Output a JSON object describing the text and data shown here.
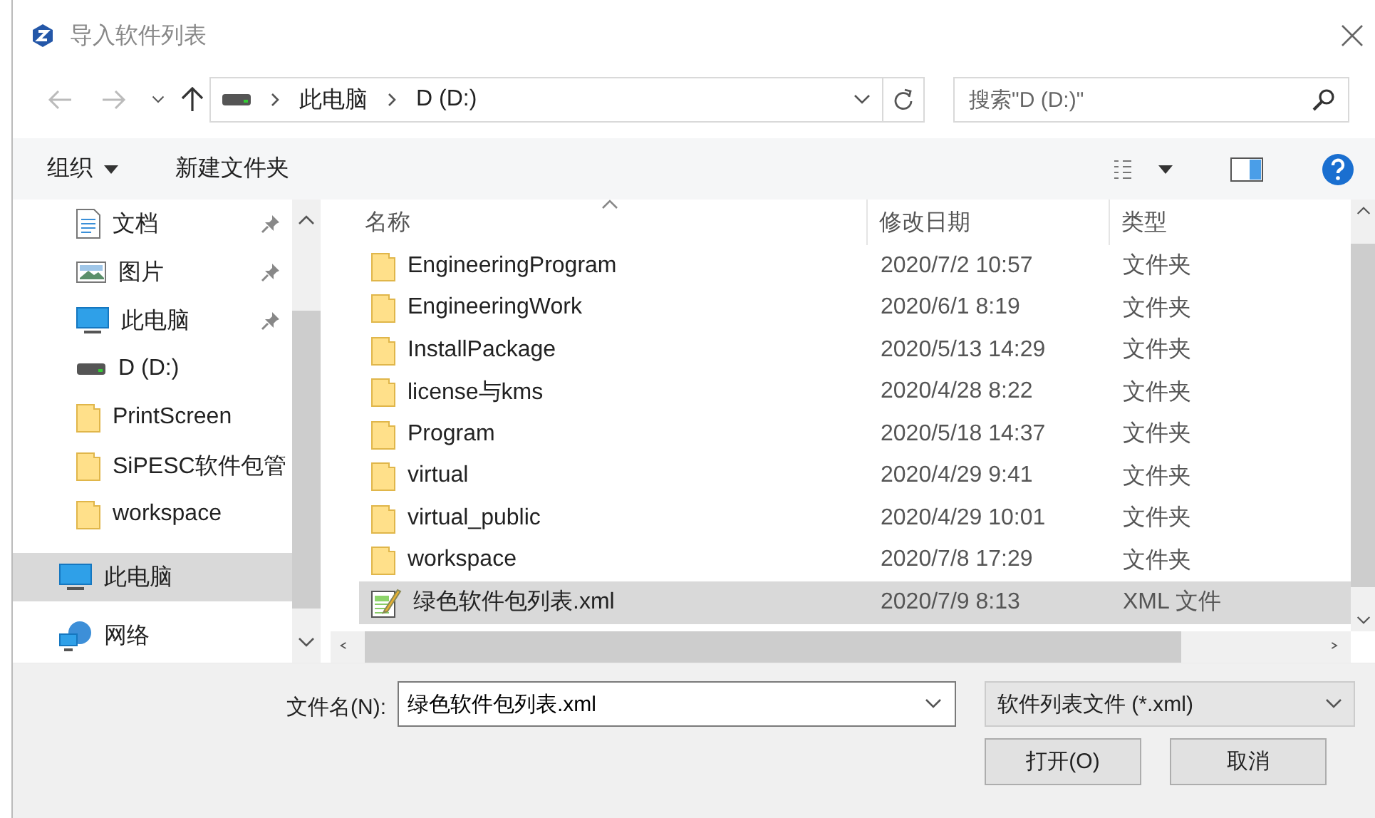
{
  "window": {
    "title": "导入软件列表"
  },
  "address_bar": {
    "path": [
      "此电脑",
      "D (D:)"
    ]
  },
  "search": {
    "placeholder": "搜索\"D (D:)\""
  },
  "toolbar": {
    "organize": "组织",
    "new_folder": "新建文件夹"
  },
  "nav": {
    "quick_access": [
      {
        "label": "文档",
        "kind": "document",
        "pinned": true
      },
      {
        "label": "图片",
        "kind": "pictures",
        "pinned": true
      },
      {
        "label": "此电脑",
        "kind": "computer",
        "pinned": true
      },
      {
        "label": "D (D:)",
        "kind": "drive",
        "pinned": false
      },
      {
        "label": "PrintScreen",
        "kind": "folder",
        "pinned": false
      },
      {
        "label": "SiPESC软件包管",
        "kind": "folder",
        "pinned": false
      },
      {
        "label": "workspace",
        "kind": "folder",
        "pinned": false
      }
    ],
    "roots": [
      {
        "label": "此电脑",
        "kind": "computer",
        "selected": true
      },
      {
        "label": "网络",
        "kind": "network",
        "selected": false
      }
    ]
  },
  "table": {
    "columns": [
      "名称",
      "修改日期",
      "类型"
    ],
    "rows": [
      {
        "name": "EngineeringProgram",
        "modified": "2020/7/2 10:57",
        "type": "文件夹",
        "kind": "folder",
        "selected": false
      },
      {
        "name": "EngineeringWork",
        "modified": "2020/6/1 8:19",
        "type": "文件夹",
        "kind": "folder",
        "selected": false
      },
      {
        "name": "InstallPackage",
        "modified": "2020/5/13 14:29",
        "type": "文件夹",
        "kind": "folder",
        "selected": false
      },
      {
        "name": "license与kms",
        "modified": "2020/4/28 8:22",
        "type": "文件夹",
        "kind": "folder",
        "selected": false
      },
      {
        "name": "Program",
        "modified": "2020/5/18 14:37",
        "type": "文件夹",
        "kind": "folder",
        "selected": false
      },
      {
        "name": "virtual",
        "modified": "2020/4/29 9:41",
        "type": "文件夹",
        "kind": "folder",
        "selected": false
      },
      {
        "name": "virtual_public",
        "modified": "2020/4/29 10:01",
        "type": "文件夹",
        "kind": "folder",
        "selected": false
      },
      {
        "name": "workspace",
        "modified": "2020/7/8 17:29",
        "type": "文件夹",
        "kind": "folder",
        "selected": false
      },
      {
        "name": "绿色软件包列表.xml",
        "modified": "2020/7/9 8:13",
        "type": "XML 文件",
        "kind": "xml",
        "selected": true
      }
    ]
  },
  "filename": {
    "label": "文件名(N):",
    "value": "绿色软件包列表.xml"
  },
  "filter": {
    "value": "软件列表文件 (*.xml)"
  },
  "buttons": [
    "打开(O)",
    "取消"
  ]
}
